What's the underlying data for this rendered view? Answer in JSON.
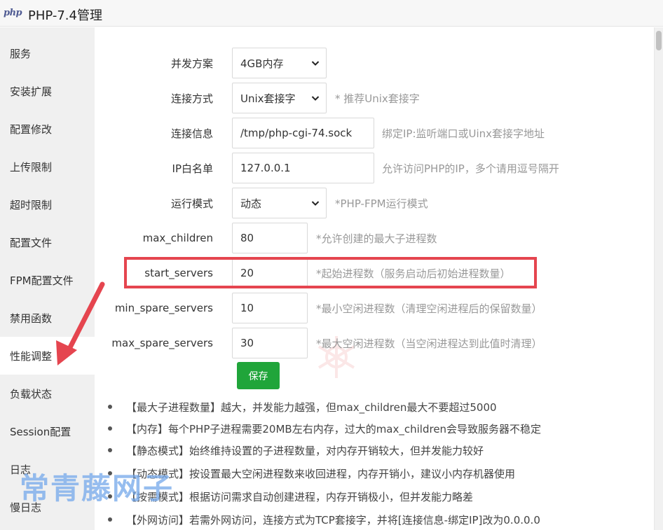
{
  "window": {
    "logo_text": "php",
    "title": "PHP-7.4管理"
  },
  "sidebar": {
    "items": [
      {
        "label": "服务"
      },
      {
        "label": "安装扩展"
      },
      {
        "label": "配置修改"
      },
      {
        "label": "上传限制"
      },
      {
        "label": "超时限制"
      },
      {
        "label": "配置文件"
      },
      {
        "label": "FPM配置文件"
      },
      {
        "label": "禁用函数"
      },
      {
        "label": "性能调整",
        "active": true
      },
      {
        "label": "负载状态"
      },
      {
        "label": "Session配置"
      },
      {
        "label": "日志"
      },
      {
        "label": "慢日志"
      }
    ]
  },
  "form": {
    "concurrency": {
      "label": "并发方案",
      "value": "4GB内存",
      "hint": ""
    },
    "connection": {
      "label": "连接方式",
      "value": "Unix套接字",
      "hint": "* 推荐Unix套接字"
    },
    "listen": {
      "label": "连接信息",
      "value": "/tmp/php-cgi-74.sock",
      "hint": "绑定IP:监听端口或Uinx套接字地址"
    },
    "whitelist": {
      "label": "IP白名单",
      "value": "127.0.0.1",
      "hint": "允许访问PHP的IP，多个请用逗号隔开"
    },
    "run_mode": {
      "label": "运行模式",
      "value": "动态",
      "hint": "*PHP-FPM运行模式"
    },
    "max_children": {
      "label": "max_children",
      "value": "80",
      "hint": "*允许创建的最大子进程数"
    },
    "start_servers": {
      "label": "start_servers",
      "value": "20",
      "hint": "*起始进程数（服务启动后初始进程数量）"
    },
    "min_spare_servers": {
      "label": "min_spare_servers",
      "value": "10",
      "hint": "*最小空闲进程数（清理空闲进程后的保留数量）"
    },
    "max_spare_servers": {
      "label": "max_spare_servers",
      "value": "30",
      "hint": "*最大空闲进程数（当空闲进程达到此值时清理）"
    },
    "save_label": "保存"
  },
  "notes": [
    "【最大子进程数量】越大，并发能力越强，但max_children最大不要超过5000",
    "【内存】每个PHP子进程需要20MB左右内存，过大的max_children会导致服务器不稳定",
    "【静态模式】始终维持设置的子进程数量，对内存开销较大，但并发能力较好",
    "【动态模式】按设置最大空闲进程数来收回进程，内存开销小，建议小内存机器使用",
    "【按需模式】根据访问需求自动创建进程，内存开销极小，但并发能力略差",
    "【外网访问】若需外网访问，连接方式为TCP套接字，并将[连接信息-绑定IP]改为0.0.0.0"
  ],
  "watermark": "常青藤网子",
  "colors": {
    "accent_green": "#20a53a",
    "highlight_red": "#e5454f",
    "sidebar_bg": "#f0f0f0",
    "watermark_blue": "#78aaeb"
  }
}
